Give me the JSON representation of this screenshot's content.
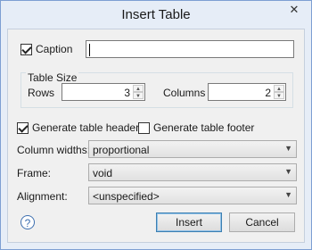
{
  "window": {
    "title": "Insert Table",
    "close_glyph": "✕"
  },
  "caption": {
    "label": "Caption",
    "checked": true,
    "value": ""
  },
  "table_size": {
    "group_label": "Table Size",
    "rows_label": "Rows",
    "rows_value": "3",
    "columns_label": "Columns",
    "columns_value": "2"
  },
  "options": {
    "header_label": "Generate table header",
    "header_checked": true,
    "footer_label": "Generate table footer",
    "footer_checked": false
  },
  "column_widths": {
    "label": "Column widths:",
    "value": "proportional"
  },
  "frame": {
    "label": "Frame:",
    "value": "void"
  },
  "alignment": {
    "label": "Alignment:",
    "value": "<unspecified>"
  },
  "buttons": {
    "insert": "Insert",
    "cancel": "Cancel",
    "help_glyph": "?"
  }
}
